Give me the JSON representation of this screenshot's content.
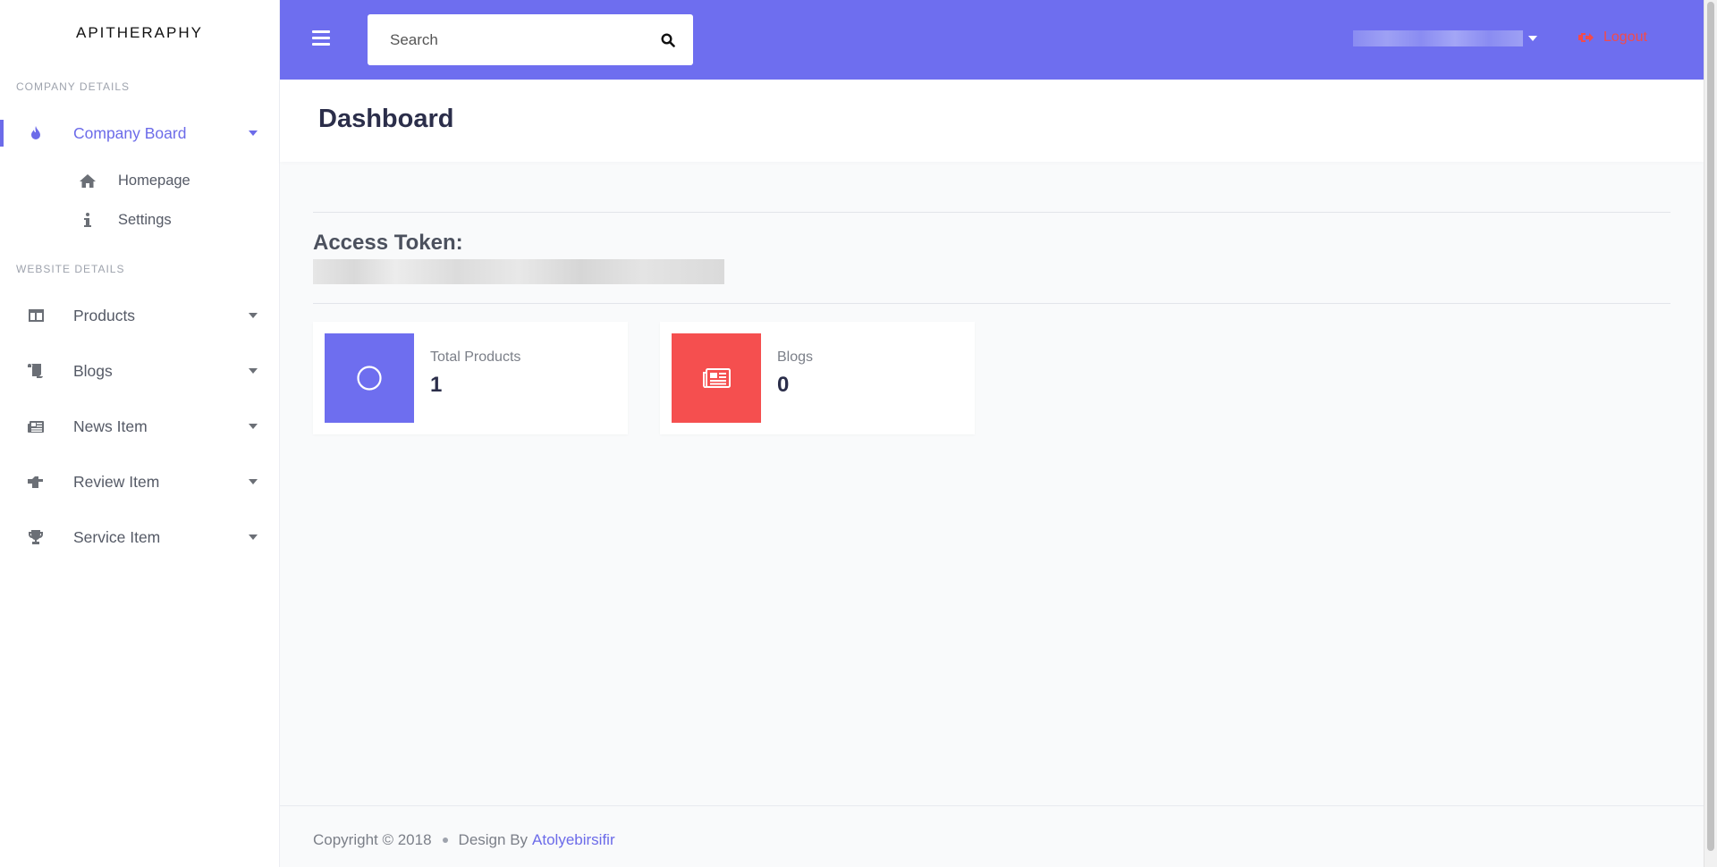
{
  "brand": "APITHERAPHY",
  "sidebar": {
    "sections": [
      {
        "title": "COMPANY DETAILS"
      },
      {
        "title": "WEBSITE DETAILS"
      }
    ],
    "company_board": {
      "label": "Company Board",
      "icon": "flame-icon"
    },
    "sub_items": [
      {
        "label": "Homepage",
        "icon": "home-icon"
      },
      {
        "label": "Settings",
        "icon": "info-icon"
      }
    ],
    "items": [
      {
        "label": "Products",
        "icon": "layout-icon"
      },
      {
        "label": "Blogs",
        "icon": "scroll-icon"
      },
      {
        "label": "News Item",
        "icon": "newspaper-icon"
      },
      {
        "label": "Review Item",
        "icon": "hand-pointer-icon"
      },
      {
        "label": "Service Item",
        "icon": "trophy-icon"
      }
    ]
  },
  "header": {
    "search_placeholder": "Search",
    "logout_label": "Logout",
    "accent": "#6e6eef"
  },
  "page": {
    "title": "Dashboard",
    "token_label": "Access Token:"
  },
  "cards": [
    {
      "title": "Total Products",
      "value": "1",
      "color": "#6e6eef",
      "icon": "circle-icon"
    },
    {
      "title": "Blogs",
      "value": "0",
      "color": "#f54f4f",
      "icon": "newspaper-icon"
    }
  ],
  "footer": {
    "copyright": "Copyright © 2018",
    "design_by": "Design By",
    "link": "Atolyebirsifir"
  }
}
